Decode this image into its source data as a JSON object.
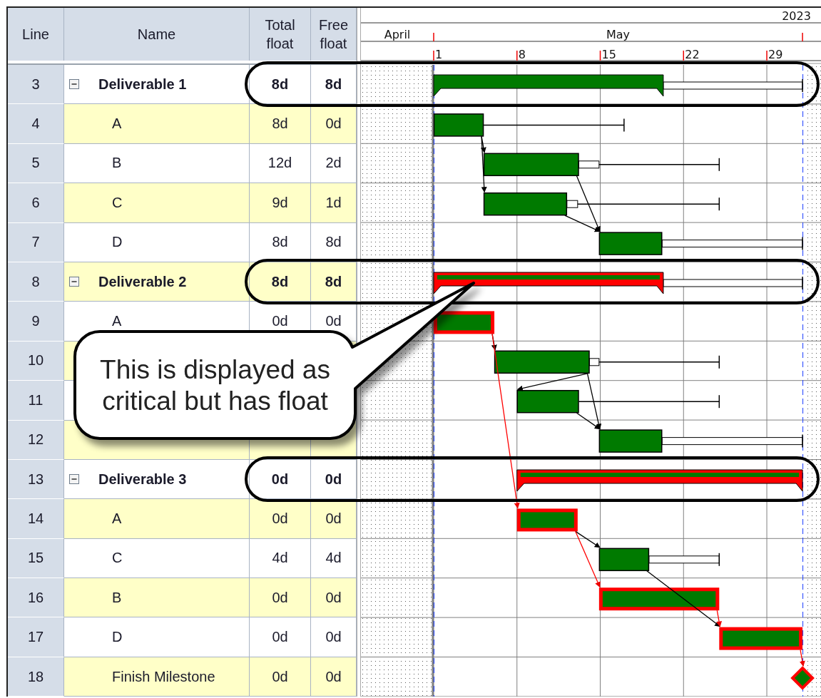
{
  "columns": [
    {
      "label": "Line"
    },
    {
      "label": "Name"
    },
    {
      "label": "Total float"
    },
    {
      "label": "Free float"
    }
  ],
  "timeline": {
    "year": "2023",
    "months": [
      {
        "label": "April"
      },
      {
        "label": "May"
      }
    ],
    "days": [
      {
        "label": "1"
      },
      {
        "label": "8"
      },
      {
        "label": "15"
      },
      {
        "label": "22"
      },
      {
        "label": "29"
      }
    ]
  },
  "rows": [
    {
      "line": "3",
      "kind": "summary",
      "expanded": true,
      "name": "Deliverable 1",
      "total_float": "8d",
      "free_float": "8d",
      "outlined": true,
      "bar": {
        "kind": "summary",
        "critical": false
      }
    },
    {
      "line": "4",
      "kind": "task",
      "name": "A",
      "total_float": "8d",
      "free_float": "0d",
      "outlined": false,
      "bar": {
        "kind": "task",
        "critical": false
      }
    },
    {
      "line": "5",
      "kind": "task",
      "name": "B",
      "total_float": "12d",
      "free_float": "2d",
      "outlined": false,
      "bar": {
        "kind": "task",
        "critical": false
      }
    },
    {
      "line": "6",
      "kind": "task",
      "name": "C",
      "total_float": "9d",
      "free_float": "1d",
      "outlined": false,
      "bar": {
        "kind": "task",
        "critical": false
      }
    },
    {
      "line": "7",
      "kind": "task",
      "name": "D",
      "total_float": "8d",
      "free_float": "8d",
      "outlined": false,
      "bar": {
        "kind": "task",
        "critical": false
      }
    },
    {
      "line": "8",
      "kind": "summary",
      "expanded": true,
      "name": "Deliverable 2",
      "total_float": "8d",
      "free_float": "8d",
      "outlined": true,
      "bar": {
        "kind": "summary",
        "critical": true
      }
    },
    {
      "line": "9",
      "kind": "task",
      "name": "A",
      "total_float": "0d",
      "free_float": "0d",
      "outlined": false,
      "bar": {
        "kind": "task",
        "critical": true
      }
    },
    {
      "line": "10",
      "kind": "task",
      "outlined": false,
      "bar": {
        "kind": "task",
        "critical": false
      }
    },
    {
      "line": "11",
      "kind": "task",
      "outlined": false,
      "bar": {
        "kind": "task",
        "critical": false
      }
    },
    {
      "line": "12",
      "kind": "task",
      "outlined": false,
      "bar": {
        "kind": "task",
        "critical": false
      }
    },
    {
      "line": "13",
      "kind": "summary",
      "expanded": true,
      "name": "Deliverable 3",
      "total_float": "0d",
      "free_float": "0d",
      "outlined": true,
      "bar": {
        "kind": "summary",
        "critical": true
      }
    },
    {
      "line": "14",
      "kind": "task",
      "name": "A",
      "total_float": "0d",
      "free_float": "0d",
      "outlined": false,
      "bar": {
        "kind": "task",
        "critical": true
      }
    },
    {
      "line": "15",
      "kind": "task",
      "name": "C",
      "total_float": "4d",
      "free_float": "4d",
      "outlined": false,
      "bar": {
        "kind": "task",
        "critical": false
      }
    },
    {
      "line": "16",
      "kind": "task",
      "name": "B",
      "total_float": "0d",
      "free_float": "0d",
      "outlined": false,
      "bar": {
        "kind": "task",
        "critical": true
      }
    },
    {
      "line": "17",
      "kind": "task",
      "name": "D",
      "total_float": "0d",
      "free_float": "0d",
      "outlined": false,
      "bar": {
        "kind": "task",
        "critical": true
      }
    },
    {
      "line": "18",
      "kind": "task",
      "name": "Finish Milestone",
      "total_float": "0d",
      "free_float": "0d",
      "outlined": false,
      "bar": {
        "kind": "milestone",
        "critical": true
      }
    }
  ],
  "callout": {
    "text": "This is displayed as\ncritical but has float"
  }
}
